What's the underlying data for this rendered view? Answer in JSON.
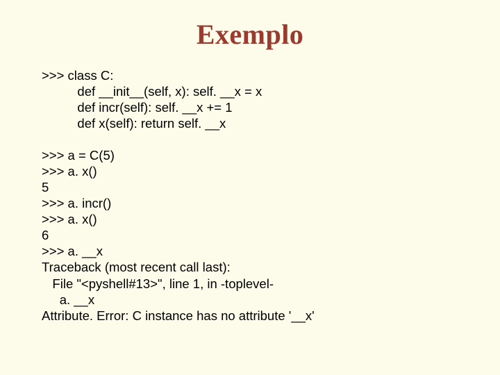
{
  "title": "Exemplo",
  "code_block_1": ">>> class C:\n          def __init__(self, x): self. __x = x\n          def incr(self): self. __x += 1\n          def x(self): return self. __x",
  "code_block_2": ">>> a = C(5)\n>>> a. x()\n5\n>>> a. incr()\n>>> a. x()\n6\n>>> a. __x\nTraceback (most recent call last):\n   File \"<pyshell#13>\", line 1, in -toplevel-\n     a. __x\nAttribute. Error: C instance has no attribute '__x'"
}
